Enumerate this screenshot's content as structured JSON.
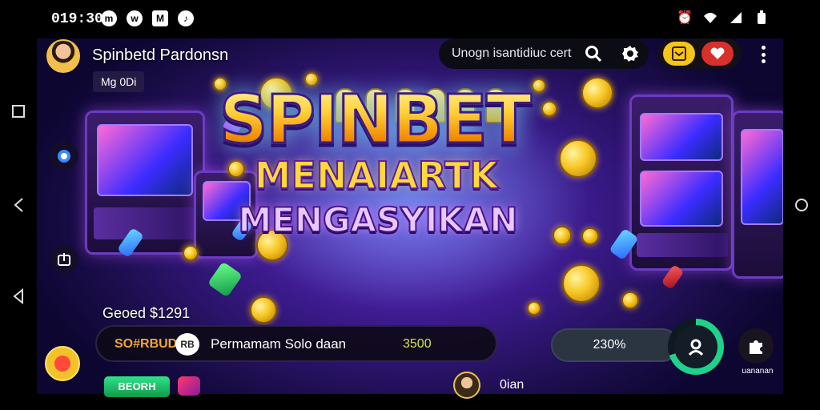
{
  "status_bar": {
    "time": "019:30",
    "left_icons": [
      "messenger-icon",
      "whatsapp-icon",
      "gmail-icon",
      "tiktok-icon"
    ],
    "right_icons": [
      "alarm-icon",
      "wifi-icon",
      "signal-icon",
      "battery-icon"
    ]
  },
  "system_nav": {
    "buttons": [
      "recent-apps-icon",
      "back-icon",
      "back-arrow-icon",
      "home-icon"
    ]
  },
  "header": {
    "player_name": "Spinbetd Pardonsn",
    "player_tag": "Mg 0Di",
    "search_placeholder": "Unogn isantidiuc cert",
    "icons": {
      "search": "search-icon",
      "settings": "gear-icon",
      "gift": "gift-icon",
      "favorite": "heart-icon",
      "menu": "more-vert-icon"
    }
  },
  "logo": {
    "title": "SPINBET",
    "line1": "MENAIARTK",
    "line2": "MENGASYIKAN"
  },
  "bottom": {
    "balance_label": "Geoed $1291",
    "bet_code": "SO#RBUD",
    "bet_icon_text": "RB",
    "bet_text": "Permamam Solo daan",
    "bet_amount": "3500",
    "progress_text": "230%",
    "progress_value": 0.7,
    "puzzle_label": "uananan",
    "green_button_label": "BEORH",
    "friend_name": "0ian"
  },
  "colors": {
    "accent_gold": "#f7c623",
    "accent_green": "#1fd18a",
    "accent_red": "#d8302a",
    "background_purple": "#3a1a8a"
  }
}
